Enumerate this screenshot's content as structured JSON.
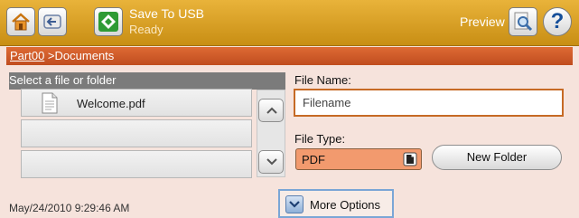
{
  "header": {
    "title": "Save To USB",
    "status": "Ready",
    "preview_label": "Preview",
    "help_label": "?"
  },
  "breadcrumb": {
    "root": "Part00",
    "separator": " >",
    "current": "Documents"
  },
  "file_list": {
    "header": "Select a file or folder",
    "items": [
      "Welcome.pdf",
      "",
      ""
    ]
  },
  "form": {
    "file_name_label": "File Name:",
    "file_name_placeholder": "Filename",
    "file_name_value": "",
    "file_type_label": "File Type:",
    "file_type_value": "PDF",
    "new_folder_label": "New Folder"
  },
  "footer": {
    "timestamp": "May/24/2010 9:29:46 AM",
    "more_options_label": "More Options"
  },
  "colors": {
    "header": "#d9a12a",
    "breadcrumb_bar": "#cf5a27",
    "panel_bg": "#f6e3dc",
    "input_border": "#c66a25",
    "file_type_fill": "#f29a6e"
  }
}
